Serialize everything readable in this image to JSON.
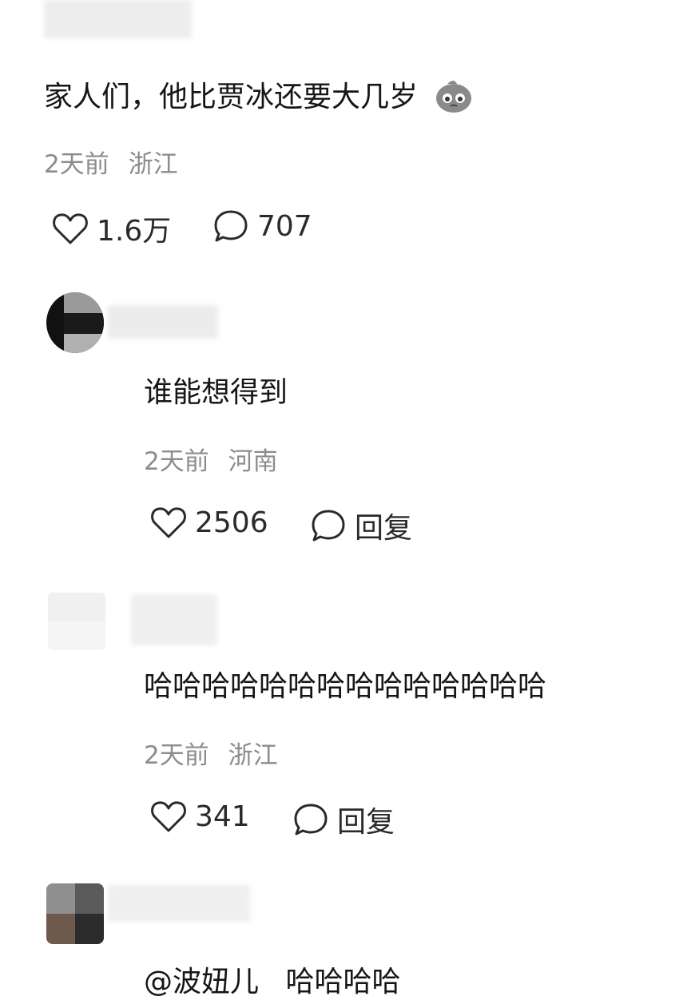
{
  "comments": [
    {
      "text": "家人们，他比贾冰还要大几岁",
      "emoji": "pleading-face-icon",
      "time": "2天前",
      "location": "浙江",
      "likes": "1.6万",
      "replies": "707"
    },
    {
      "text": "谁能想得到",
      "time": "2天前",
      "location": "河南",
      "likes": "2506",
      "reply_label": "回复"
    },
    {
      "text": "哈哈哈哈哈哈哈哈哈哈哈哈哈哈",
      "time": "2天前",
      "location": "浙江",
      "likes": "341",
      "reply_label": "回复"
    },
    {
      "mention": "@波妞儿",
      "text": "哈哈哈哈"
    }
  ]
}
